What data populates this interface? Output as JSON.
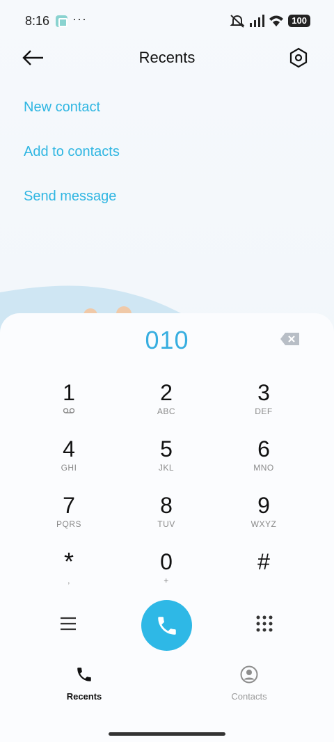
{
  "status": {
    "time": "8:16",
    "notif_dots": "···",
    "battery": "100"
  },
  "header": {
    "title": "Recents",
    "back_icon": "arrow-left-icon",
    "settings_icon": "hexagon-settings-icon"
  },
  "actions": [
    {
      "label": "New contact"
    },
    {
      "label": "Add to contacts"
    },
    {
      "label": "Send message"
    }
  ],
  "dialpad": {
    "number": "010",
    "keys": [
      {
        "digit": "1",
        "sub": "voicemail-icon"
      },
      {
        "digit": "2",
        "sub": "ABC"
      },
      {
        "digit": "3",
        "sub": "DEF"
      },
      {
        "digit": "4",
        "sub": "GHI"
      },
      {
        "digit": "5",
        "sub": "JKL"
      },
      {
        "digit": "6",
        "sub": "MNO"
      },
      {
        "digit": "7",
        "sub": "PQRS"
      },
      {
        "digit": "8",
        "sub": "TUV"
      },
      {
        "digit": "9",
        "sub": "WXYZ"
      },
      {
        "digit": "*",
        "sub": ","
      },
      {
        "digit": "0",
        "sub": "+"
      },
      {
        "digit": "#",
        "sub": ""
      }
    ]
  },
  "bottom_nav": {
    "tabs": [
      {
        "label": "Recents",
        "icon": "phone-icon",
        "active": true
      },
      {
        "label": "Contacts",
        "icon": "person-circle-icon",
        "active": false
      }
    ]
  },
  "colors": {
    "accent": "#2eb8e6",
    "link": "#2fb6e2",
    "number": "#37aee0"
  }
}
